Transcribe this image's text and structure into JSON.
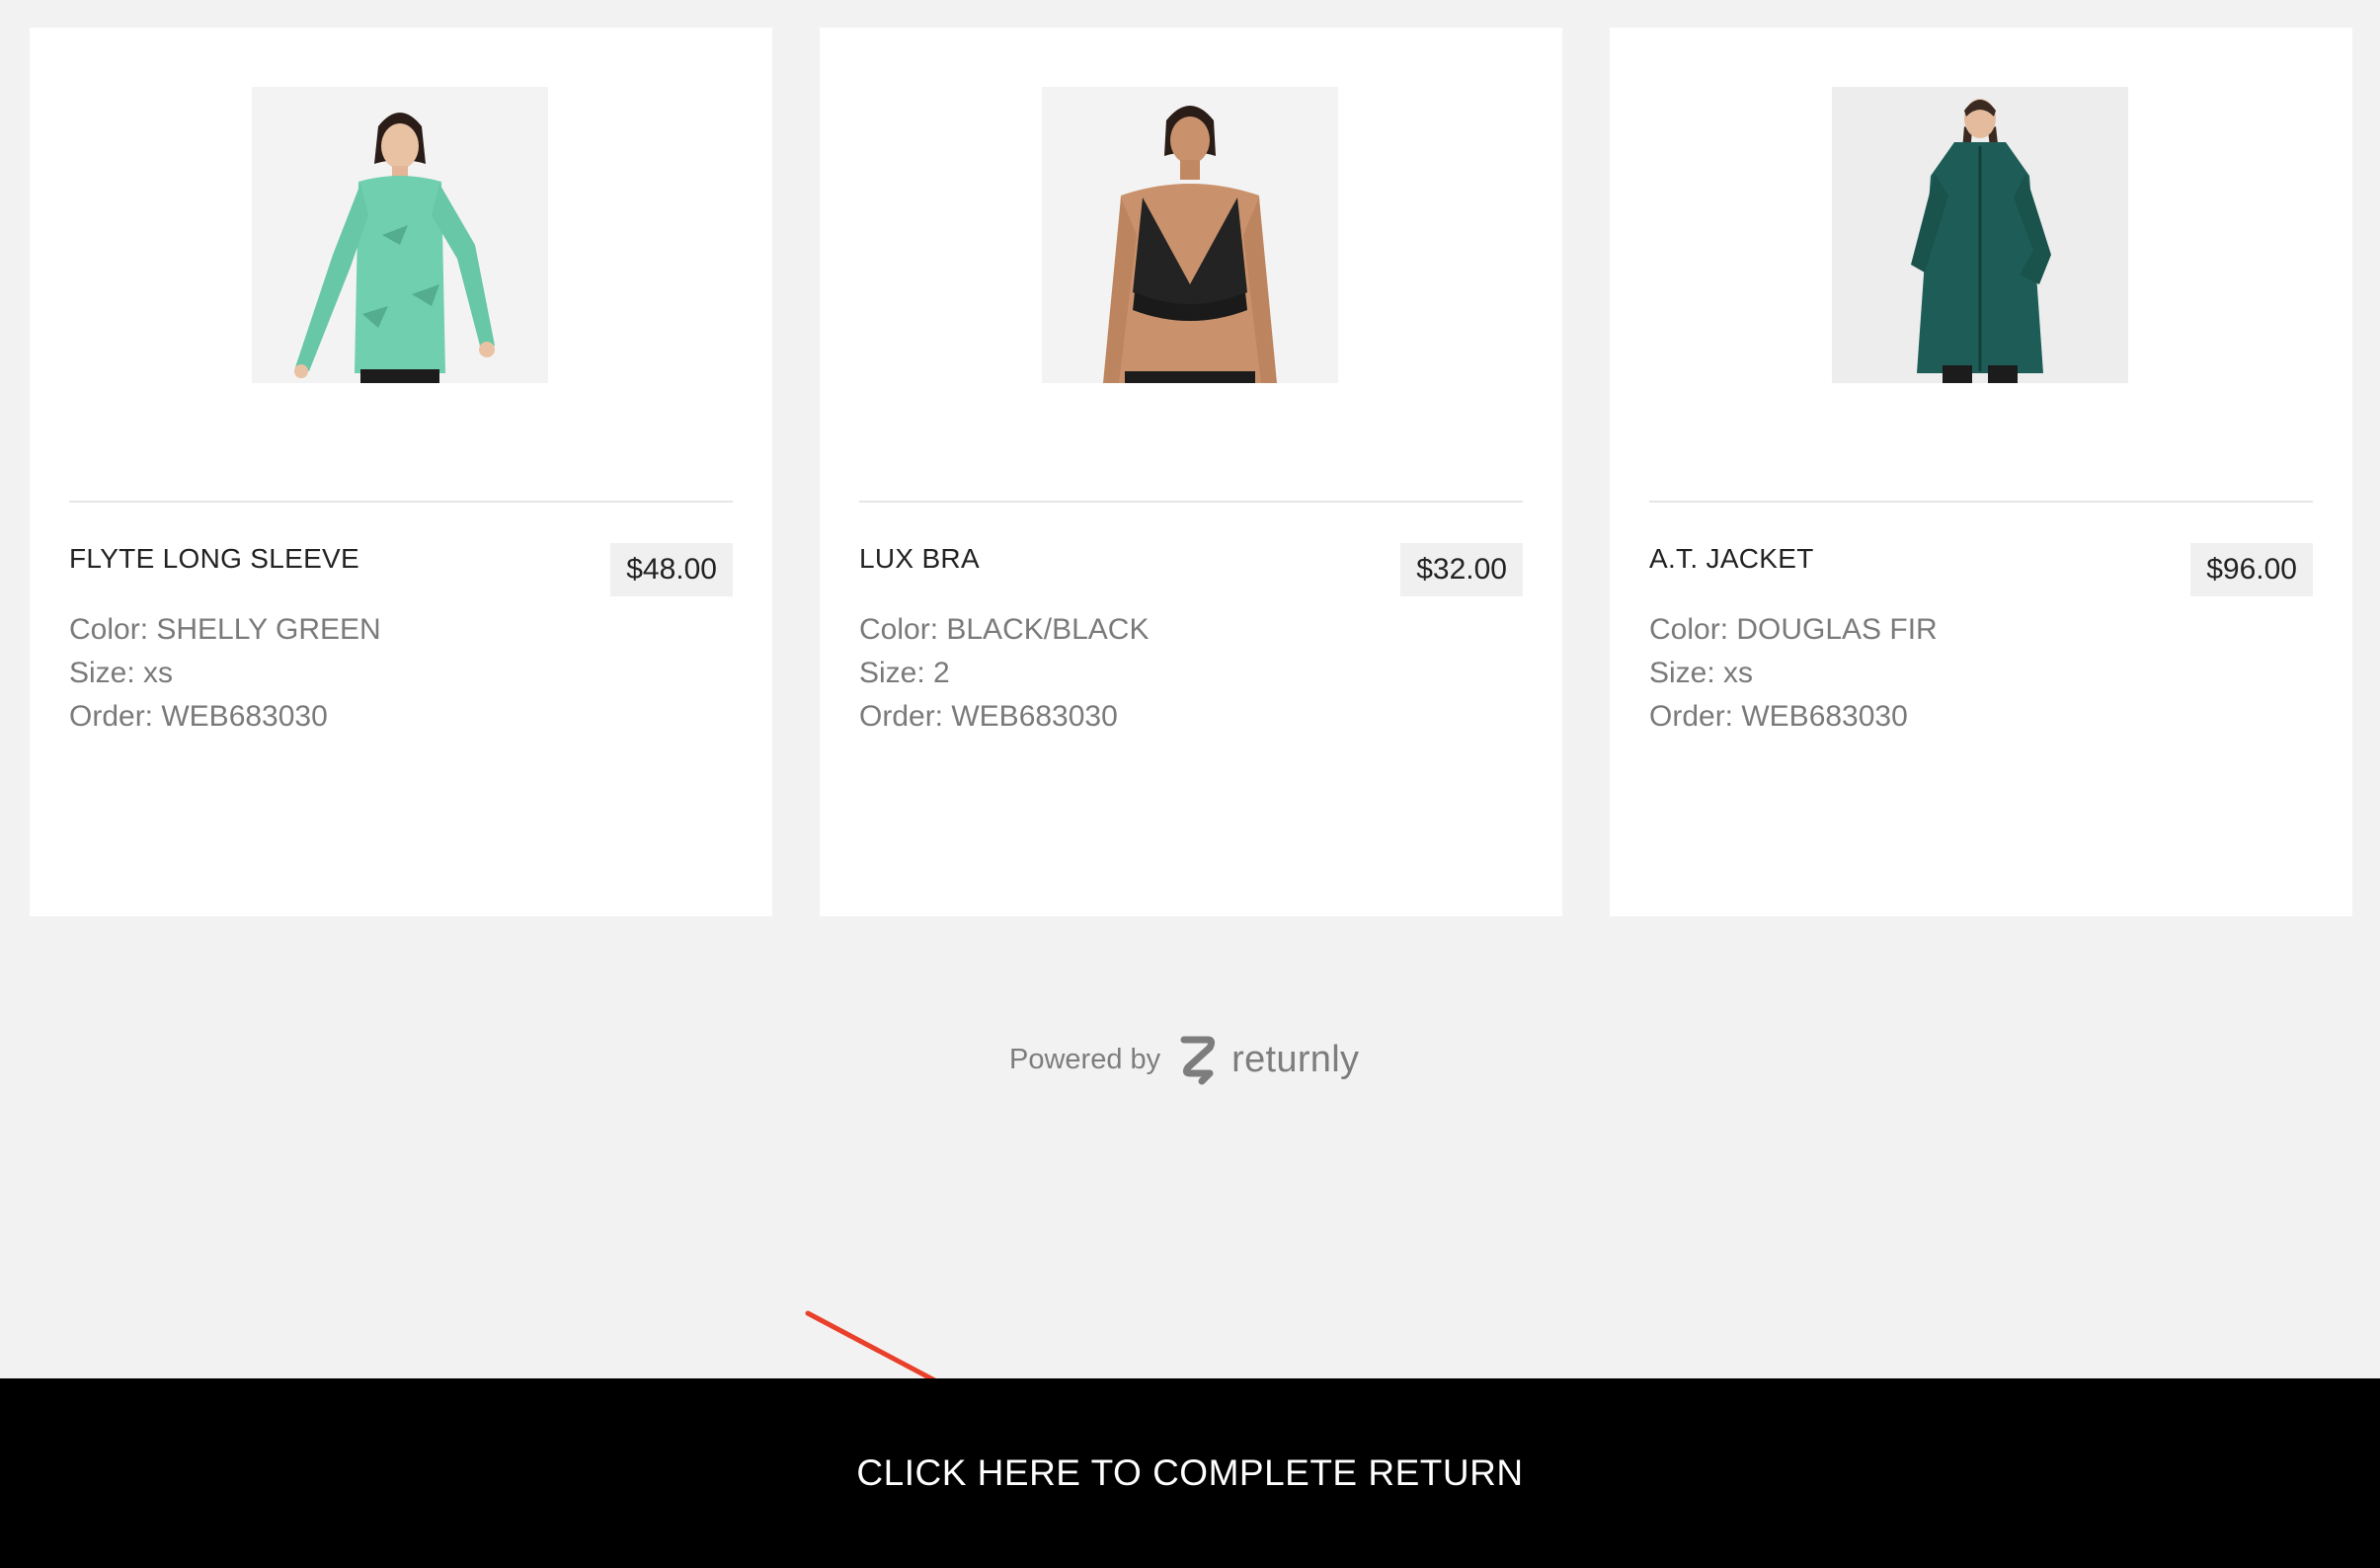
{
  "items": [
    {
      "name": "FLYTE LONG SLEEVE",
      "price": "$48.00",
      "color": "Color: SHELLY GREEN",
      "size": "Size: xs",
      "order": "Order: WEB683030",
      "image_icon": "product-photo-long-sleeve",
      "product_color": "#6fcfae"
    },
    {
      "name": "LUX BRA",
      "price": "$32.00",
      "color": "Color: BLACK/BLACK",
      "size": "Size: 2",
      "order": "Order: WEB683030",
      "image_icon": "product-photo-bra",
      "product_color": "#232323"
    },
    {
      "name": "A.T. JACKET",
      "price": "$96.00",
      "color": "Color: DOUGLAS FIR",
      "size": "Size: xs",
      "order": "Order: WEB683030",
      "image_icon": "product-photo-jacket",
      "product_color": "#1e5d57"
    }
  ],
  "footer": {
    "powered_by": "Powered by",
    "brand": "returnly",
    "logo_icon": "returnly-logo-icon"
  },
  "cta": {
    "label": "CLICK HERE TO COMPLETE RETURN"
  },
  "annotation": {
    "icon": "red-arrow-icon",
    "color": "#e8402a"
  },
  "colors": {
    "page_background": "#f2f2f2",
    "card_background": "#ffffff",
    "cta_background": "#000000",
    "muted_text": "#7a7a7a"
  }
}
